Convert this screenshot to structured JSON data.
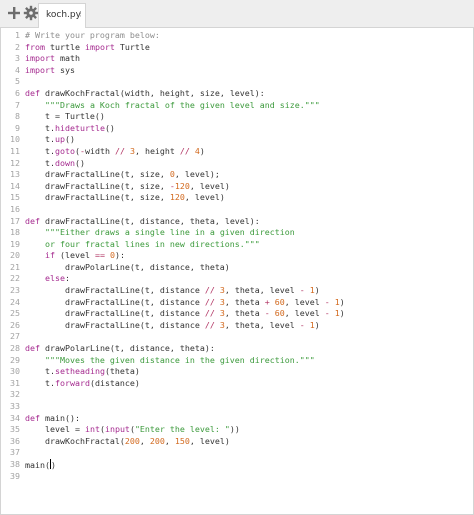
{
  "toolbar": {
    "add_icon": "plus-icon",
    "settings_icon": "gear-icon"
  },
  "tab": {
    "label": "koch.py",
    "menu_glyph": "⁝"
  },
  "colors": {
    "keyword": "#a52a8f",
    "comment": "#8e8e8e",
    "string": "#3c9a3c",
    "number": "#d2691e",
    "operator": "#b03060"
  },
  "code_lines": [
    {
      "n": "1",
      "t": [
        [
          "comment",
          "# Write your program below:"
        ]
      ]
    },
    {
      "n": "2",
      "t": [
        [
          "keyword",
          "from"
        ],
        [
          "plain",
          " turtle "
        ],
        [
          "keyword",
          "import"
        ],
        [
          "plain",
          " Turtle"
        ]
      ]
    },
    {
      "n": "3",
      "t": [
        [
          "keyword",
          "import"
        ],
        [
          "plain",
          " math"
        ]
      ]
    },
    {
      "n": "4",
      "t": [
        [
          "keyword",
          "import"
        ],
        [
          "plain",
          " sys"
        ]
      ]
    },
    {
      "n": "5",
      "t": []
    },
    {
      "n": "6",
      "t": [
        [
          "keyword",
          "def"
        ],
        [
          "plain",
          " drawKochFractal(width, height, size, level):"
        ]
      ]
    },
    {
      "n": "7",
      "t": [
        [
          "plain",
          "    "
        ],
        [
          "string",
          "\"\"\"Draws a Koch fractal of the given level and size.\"\"\""
        ]
      ]
    },
    {
      "n": "8",
      "t": [
        [
          "plain",
          "    t = Turtle()"
        ]
      ]
    },
    {
      "n": "9",
      "t": [
        [
          "plain",
          "    t."
        ],
        [
          "method",
          "hideturtle"
        ],
        [
          "plain",
          "()"
        ]
      ]
    },
    {
      "n": "10",
      "t": [
        [
          "plain",
          "    t."
        ],
        [
          "method",
          "up"
        ],
        [
          "plain",
          "()"
        ]
      ]
    },
    {
      "n": "11",
      "t": [
        [
          "plain",
          "    t."
        ],
        [
          "method",
          "goto"
        ],
        [
          "plain",
          "("
        ],
        [
          "operator",
          "-"
        ],
        [
          "plain",
          "width "
        ],
        [
          "operator",
          "//"
        ],
        [
          "plain",
          " "
        ],
        [
          "number",
          "3"
        ],
        [
          "plain",
          ", height "
        ],
        [
          "operator",
          "//"
        ],
        [
          "plain",
          " "
        ],
        [
          "number",
          "4"
        ],
        [
          "plain",
          ")"
        ]
      ]
    },
    {
      "n": "12",
      "t": [
        [
          "plain",
          "    t."
        ],
        [
          "method",
          "down"
        ],
        [
          "plain",
          "()"
        ]
      ]
    },
    {
      "n": "13",
      "t": [
        [
          "plain",
          "    drawFractalLine(t, size, "
        ],
        [
          "number",
          "0"
        ],
        [
          "plain",
          ", level);"
        ]
      ]
    },
    {
      "n": "14",
      "t": [
        [
          "plain",
          "    drawFractalLine(t, size, "
        ],
        [
          "operator",
          "-"
        ],
        [
          "number",
          "120"
        ],
        [
          "plain",
          ", level)"
        ]
      ]
    },
    {
      "n": "15",
      "t": [
        [
          "plain",
          "    drawFractalLine(t, size, "
        ],
        [
          "number",
          "120"
        ],
        [
          "plain",
          ", level)"
        ]
      ]
    },
    {
      "n": "16",
      "t": []
    },
    {
      "n": "17",
      "t": [
        [
          "keyword",
          "def"
        ],
        [
          "plain",
          " drawFractalLine(t, distance, theta, level):"
        ]
      ]
    },
    {
      "n": "18",
      "t": [
        [
          "plain",
          "    "
        ],
        [
          "string",
          "\"\"\"Either draws a single line in a given direction"
        ]
      ]
    },
    {
      "n": "19",
      "t": [
        [
          "string",
          "    or four fractal lines in new directions.\"\"\""
        ]
      ]
    },
    {
      "n": "20",
      "t": [
        [
          "plain",
          "    "
        ],
        [
          "keyword",
          "if"
        ],
        [
          "plain",
          " (level "
        ],
        [
          "operator",
          "=="
        ],
        [
          "plain",
          " "
        ],
        [
          "number",
          "0"
        ],
        [
          "plain",
          "):"
        ]
      ]
    },
    {
      "n": "21",
      "t": [
        [
          "plain",
          "        drawPolarLine(t, distance, theta)"
        ]
      ]
    },
    {
      "n": "22",
      "t": [
        [
          "plain",
          "    "
        ],
        [
          "keyword",
          "else"
        ],
        [
          "plain",
          ":"
        ]
      ]
    },
    {
      "n": "23",
      "t": [
        [
          "plain",
          "        drawFractalLine(t, distance "
        ],
        [
          "operator",
          "//"
        ],
        [
          "plain",
          " "
        ],
        [
          "number",
          "3"
        ],
        [
          "plain",
          ", theta, level "
        ],
        [
          "operator",
          "-"
        ],
        [
          "plain",
          " "
        ],
        [
          "number",
          "1"
        ],
        [
          "plain",
          ")"
        ]
      ]
    },
    {
      "n": "24",
      "t": [
        [
          "plain",
          "        drawFractalLine(t, distance "
        ],
        [
          "operator",
          "//"
        ],
        [
          "plain",
          " "
        ],
        [
          "number",
          "3"
        ],
        [
          "plain",
          ", theta "
        ],
        [
          "operator",
          "+"
        ],
        [
          "plain",
          " "
        ],
        [
          "number",
          "60"
        ],
        [
          "plain",
          ", level "
        ],
        [
          "operator",
          "-"
        ],
        [
          "plain",
          " "
        ],
        [
          "number",
          "1"
        ],
        [
          "plain",
          ")"
        ]
      ]
    },
    {
      "n": "25",
      "t": [
        [
          "plain",
          "        drawFractalLine(t, distance "
        ],
        [
          "operator",
          "//"
        ],
        [
          "plain",
          " "
        ],
        [
          "number",
          "3"
        ],
        [
          "plain",
          ", theta "
        ],
        [
          "operator",
          "-"
        ],
        [
          "plain",
          " "
        ],
        [
          "number",
          "60"
        ],
        [
          "plain",
          ", level "
        ],
        [
          "operator",
          "-"
        ],
        [
          "plain",
          " "
        ],
        [
          "number",
          "1"
        ],
        [
          "plain",
          ")"
        ]
      ]
    },
    {
      "n": "26",
      "t": [
        [
          "plain",
          "        drawFractalLine(t, distance "
        ],
        [
          "operator",
          "//"
        ],
        [
          "plain",
          " "
        ],
        [
          "number",
          "3"
        ],
        [
          "plain",
          ", theta, level "
        ],
        [
          "operator",
          "-"
        ],
        [
          "plain",
          " "
        ],
        [
          "number",
          "1"
        ],
        [
          "plain",
          ")"
        ]
      ]
    },
    {
      "n": "27",
      "t": []
    },
    {
      "n": "28",
      "t": [
        [
          "keyword",
          "def"
        ],
        [
          "plain",
          " drawPolarLine(t, distance, theta):"
        ]
      ]
    },
    {
      "n": "29",
      "t": [
        [
          "plain",
          "    "
        ],
        [
          "string",
          "\"\"\"Moves the given distance in the given direction.\"\"\""
        ]
      ]
    },
    {
      "n": "30",
      "t": [
        [
          "plain",
          "    t."
        ],
        [
          "method",
          "setheading"
        ],
        [
          "plain",
          "(theta)"
        ]
      ]
    },
    {
      "n": "31",
      "t": [
        [
          "plain",
          "    t."
        ],
        [
          "method",
          "forward"
        ],
        [
          "plain",
          "(distance)"
        ]
      ]
    },
    {
      "n": "32",
      "t": []
    },
    {
      "n": "33",
      "t": []
    },
    {
      "n": "34",
      "t": [
        [
          "keyword",
          "def"
        ],
        [
          "plain",
          " main():"
        ]
      ]
    },
    {
      "n": "35",
      "t": [
        [
          "plain",
          "    level = "
        ],
        [
          "method",
          "int"
        ],
        [
          "plain",
          "("
        ],
        [
          "method",
          "input"
        ],
        [
          "plain",
          "("
        ],
        [
          "string",
          "\"Enter the level: \""
        ],
        [
          "plain",
          "))"
        ]
      ]
    },
    {
      "n": "36",
      "t": [
        [
          "plain",
          "    drawKochFractal("
        ],
        [
          "number",
          "200"
        ],
        [
          "plain",
          ", "
        ],
        [
          "number",
          "200"
        ],
        [
          "plain",
          ", "
        ],
        [
          "number",
          "150"
        ],
        [
          "plain",
          ", level)"
        ]
      ]
    },
    {
      "n": "37",
      "t": []
    },
    {
      "n": "38",
      "t": [
        [
          "plain",
          "main("
        ],
        [
          "cursor",
          ""
        ],
        [
          "plain",
          ")"
        ]
      ]
    },
    {
      "n": "39",
      "t": []
    }
  ]
}
